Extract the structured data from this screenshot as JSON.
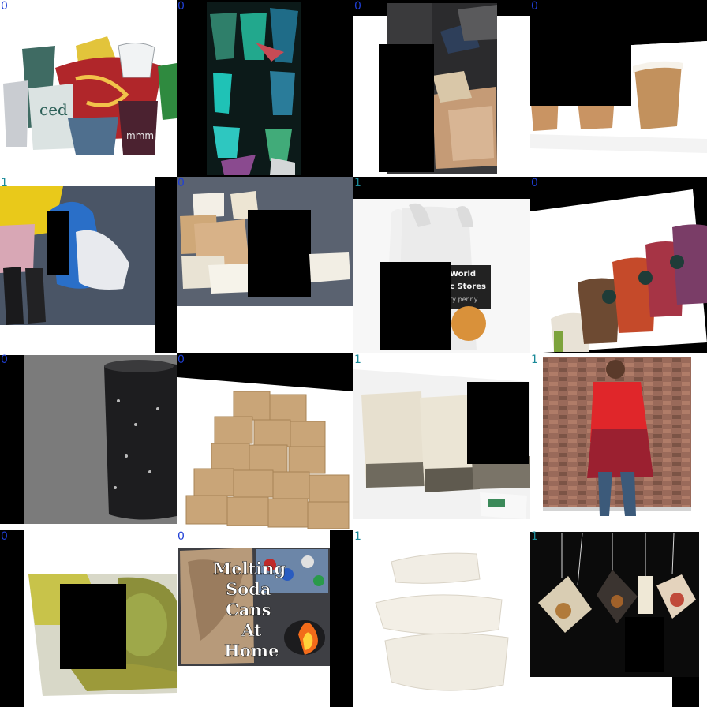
{
  "grid": {
    "tiles": [
      {
        "label": "0",
        "subject": "assorted paper cups",
        "label_color": "#1f3fd6"
      },
      {
        "label": "0",
        "subject": "green paper cups on black",
        "label_color": "#1f3fd6"
      },
      {
        "label": "0",
        "subject": "flattened cardboard in alley",
        "label_color": "#1f3fd6"
      },
      {
        "label": "0",
        "subject": "kraft paper cups",
        "label_color": "#1f3fd6"
      },
      {
        "label": "1",
        "subject": "plastic shopping bags",
        "label_color": "#1b8a99"
      },
      {
        "label": "0",
        "subject": "cardboard boxes",
        "label_color": "#1f3fd6"
      },
      {
        "label": "1",
        "subject": "white plastic bag",
        "label_color": "#1b8a99"
      },
      {
        "label": "0",
        "subject": "colored paper coffee cups",
        "label_color": "#1f3fd6"
      },
      {
        "label": "0",
        "subject": "black aluminum can",
        "label_color": "#1f3fd6"
      },
      {
        "label": "0",
        "subject": "stacked cardboard boxes",
        "label_color": "#1f3fd6"
      },
      {
        "label": "1",
        "subject": "tea bags",
        "label_color": "#1b8a99"
      },
      {
        "label": "1",
        "subject": "person by brick wall",
        "label_color": "#1b8a99"
      },
      {
        "label": "0",
        "subject": "pickles in bowl",
        "label_color": "#1f3fd6"
      },
      {
        "label": "0",
        "subject": "melting soda cans thumbnail",
        "label_color": "#1f3fd6"
      },
      {
        "label": "1",
        "subject": "white takeout containers",
        "label_color": "#1b8a99"
      },
      {
        "label": "1",
        "subject": "hanging tea bags",
        "label_color": "#1b8a99"
      }
    ],
    "texts": {
      "cup_text": "ced",
      "cup_brand": "mmm",
      "sign_line1": "World",
      "sign_line2": "c Stores",
      "sign_line3": "ry penny",
      "thumb_l1": "Melting",
      "thumb_l2": "Soda",
      "thumb_l3": "Cans",
      "thumb_l4": "At",
      "thumb_l5": "Home"
    }
  }
}
